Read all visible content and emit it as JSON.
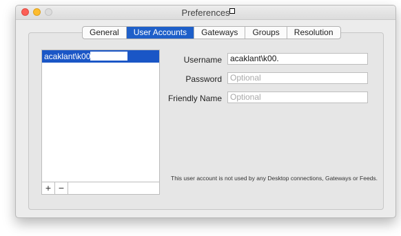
{
  "window": {
    "title": "Preferences"
  },
  "tabs": [
    {
      "label": "General",
      "active": false
    },
    {
      "label": "User Accounts",
      "active": true
    },
    {
      "label": "Gateways",
      "active": false
    },
    {
      "label": "Groups",
      "active": false
    },
    {
      "label": "Resolution",
      "active": false
    }
  ],
  "accounts": {
    "items": [
      {
        "label": "acaklant\\k00"
      }
    ],
    "add_label": "+",
    "remove_label": "−"
  },
  "form": {
    "username_label": "Username",
    "username_value": "acaklant\\k00.",
    "password_label": "Password",
    "password_placeholder": "Optional",
    "friendly_label": "Friendly Name",
    "friendly_placeholder": "Optional"
  },
  "note": "This user account is not used by any Desktop connections, Gateways or Feeds.",
  "colors": {
    "accent": "#1e5fc9",
    "close": "#fc5f57",
    "minimize": "#fdbc2e",
    "zoom": "#dcdcdc"
  }
}
